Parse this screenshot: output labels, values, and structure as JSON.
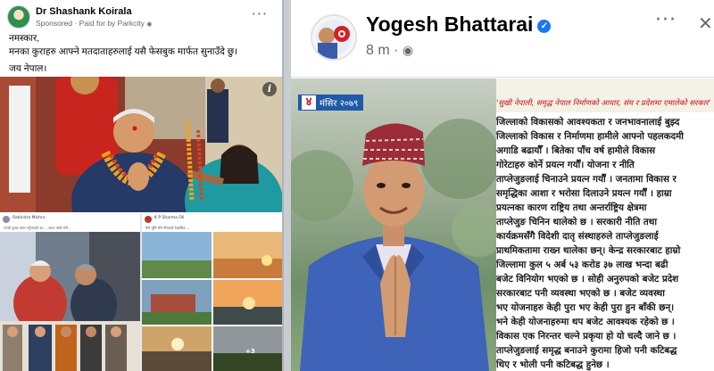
{
  "left_post": {
    "author": "Dr Shashank Koirala",
    "meta": "Sponsored · Paid for by Parkcity",
    "more": "···",
    "body_lines": [
      "नमस्कार,",
      "मनका कुराहरु आफ्ने मतदाताहरुलाई यसै फेसबुक मार्फत सुनाउँदे छु।",
      "जय नेपाल।"
    ],
    "info": "i",
    "shared_post_a": {
      "author": "Rabindra Mishra",
      "text": "ज्यादै सुन्दर काम गर्नुभएको छ। ...आज यस्तो गरी..."
    },
    "shared_post_b": {
      "author": "K P Sharma Oli",
      "text": "मेरो भूमि मेरो गौरवको रेखाचित्र ..."
    },
    "more_photos": "+3"
  },
  "right_post": {
    "author": "Yogesh Bhattarai",
    "verified": "✓",
    "time": "8 m ·",
    "globe": "🌐",
    "more": "···",
    "close": "✕",
    "date_number": "४",
    "date_label": "मंसिर २०७९",
    "slogan": "'सुखी नेपाली, समृद्ध नेपाल निर्माणको आधार, संघ र प्रदेशमा एमालेको सरकार'",
    "text_lines": [
      "जिल्लाको विकासको आवश्यकता र जनभावनालाई बुझ्द",
      "जिल्लाको विकास र निर्माणमा हामीले आफ्नो पहलकदमी",
      "अगाडि बढायौँ । बितेका पाँच वर्ष हामीले विकास",
      "गोरेटाहरु कोर्ने प्रयत्न गर्यौं। योजना र नीति",
      "ताप्लेजुङलाई चिनाउने प्रयत्न गर्यौं । जनतामा विकास र",
      "समृद्धिका आशा र भरोसा दिलाउने प्रयत्न गर्यौं । हाम्रा",
      "प्रयत्नका कारण राष्ट्रिय तथा अन्तर्राष्ट्रिय क्षेत्रमा",
      "ताप्लेजुङ चिनिन थालेको छ । सरकारी नीति तथा",
      "कार्यक्रमसँगै विदेशी दातृ संस्थाहरुले ताप्लेजुङलाई",
      "प्राथमिकतामा राख्न थालेका छन्। केन्द्र सरकारबाट हाम्रो",
      "जिल्लामा कुल ५ अर्ब ५३ करोड ३७ लाख भन्दा बढी",
      "बजेट विनियोग भएको छ । सोही अनुरुपको बजेट प्रदेश",
      "सरकारबाट पनी व्यवस्था भएको छ । बजेट व्यवस्था",
      "भए योजनाहरु केही पुरा भए केही पुरा हुन बाँकी छन्।",
      "भने केही योजनाहरुमा थप बजेट आवश्यक रहेको छ ।",
      "विकास एक निरन्तर चल्ने प्रकृया हो यो चल्दै जाने छ ।",
      "ताप्लेजुङलाई समृद्ध बनाउने कुरामा हिजो पनी कटिबद्ध",
      "थिए र भोली पनी कटिबद्ध हुनेछ ।"
    ]
  }
}
